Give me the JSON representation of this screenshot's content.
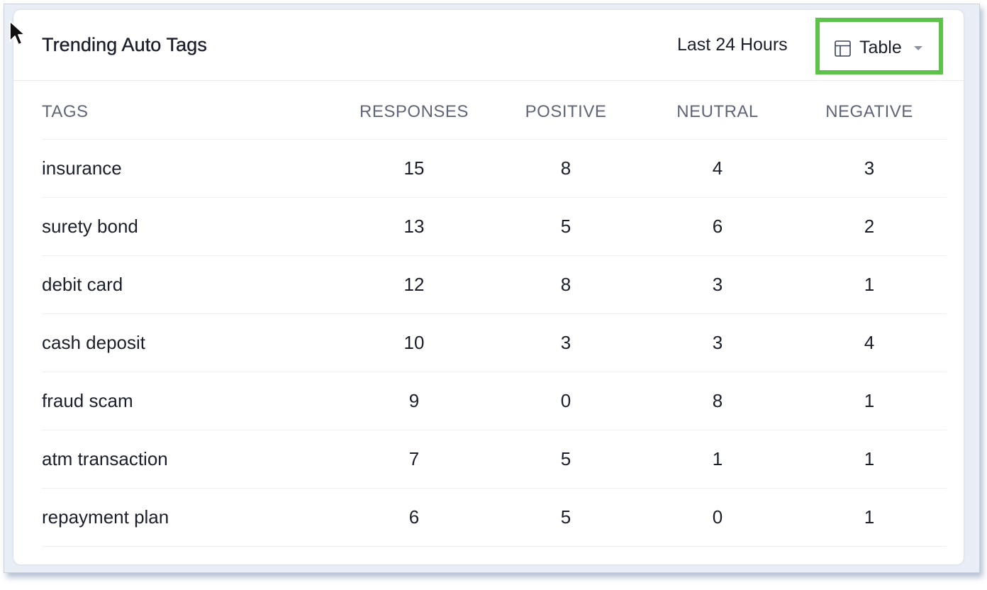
{
  "widget": {
    "title": "Trending Auto Tags",
    "range_label": "Last 24 Hours",
    "view_label": "Table",
    "view_icon": "table-icon",
    "highlight_color": "#5dc24a"
  },
  "table": {
    "headers": [
      "TAGS",
      "RESPONSES",
      "POSITIVE",
      "NEUTRAL",
      "NEGATIVE"
    ],
    "rows": [
      [
        "insurance",
        "15",
        "8",
        "4",
        "3"
      ],
      [
        "surety bond",
        "13",
        "5",
        "6",
        "2"
      ],
      [
        "debit card",
        "12",
        "8",
        "3",
        "1"
      ],
      [
        "cash deposit",
        "10",
        "3",
        "3",
        "4"
      ],
      [
        "fraud scam",
        "9",
        "0",
        "8",
        "1"
      ],
      [
        "atm transaction",
        "7",
        "5",
        "1",
        "1"
      ],
      [
        "repayment plan",
        "6",
        "5",
        "0",
        "1"
      ]
    ]
  }
}
